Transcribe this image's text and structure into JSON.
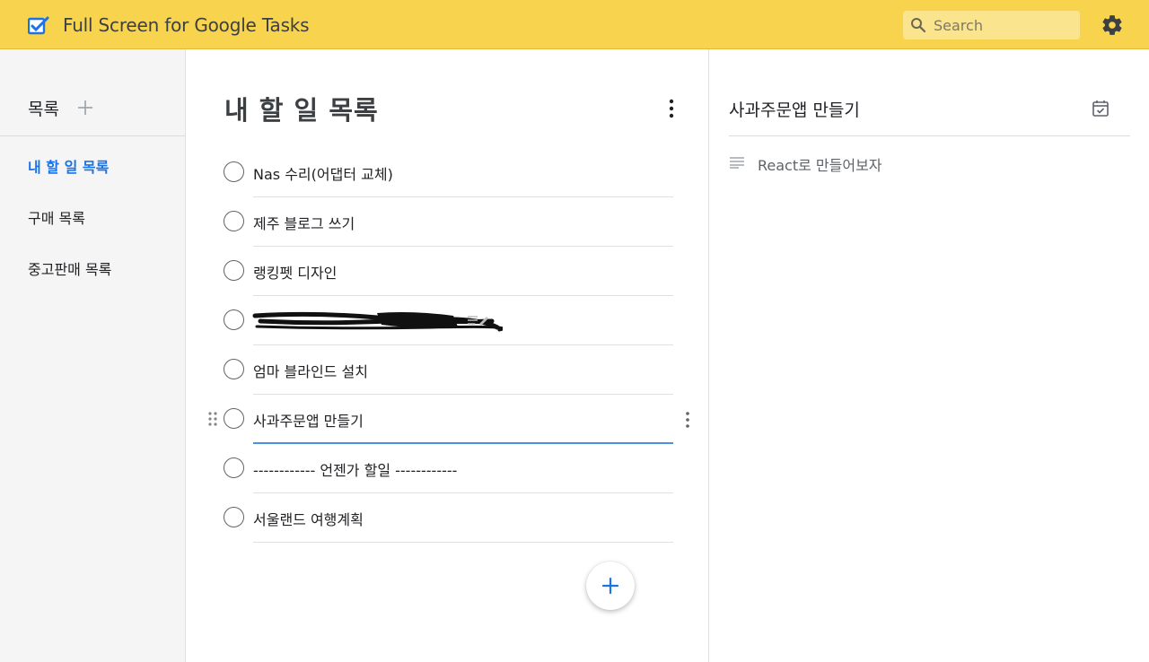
{
  "app": {
    "title": "Full Screen for Google Tasks",
    "accent": "#f8d34e"
  },
  "search": {
    "placeholder": "Search",
    "value": ""
  },
  "sidebar": {
    "title": "목록",
    "items": [
      {
        "label": "내 할 일 목록",
        "active": true
      },
      {
        "label": "구매 목록",
        "active": false
      },
      {
        "label": "중고판매 목록",
        "active": false
      }
    ],
    "active_color": "#1a73e8"
  },
  "main": {
    "list_title": "내 할 일 목록",
    "tasks": [
      {
        "title": "Nas 수리(어댑터 교체)"
      },
      {
        "title": "제주 블로그 쓰기"
      },
      {
        "title": "랭킹펫 디자인"
      },
      {
        "title": "",
        "redacted": true
      },
      {
        "title": "엄마 블라인드 설치"
      },
      {
        "title": "사과주문앱 만들기",
        "selected": true
      },
      {
        "title": "------------ 언젠가 할일 ------------"
      },
      {
        "title": "서울랜드 여행계획"
      }
    ]
  },
  "detail": {
    "title": "사과주문앱 만들기",
    "notes": "React로 만들어보자"
  }
}
